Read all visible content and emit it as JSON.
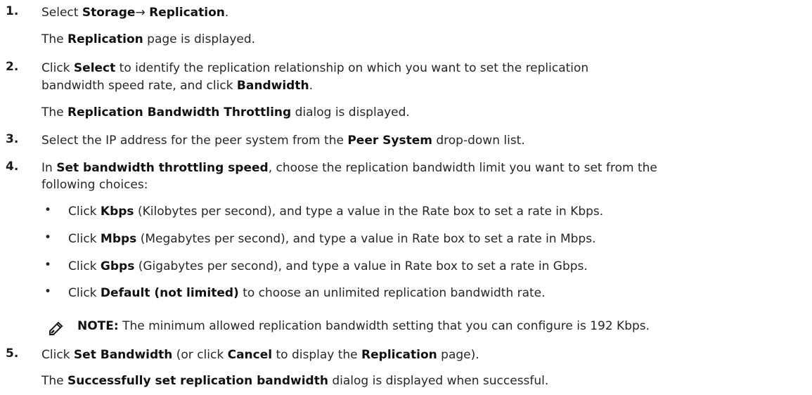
{
  "steps": [
    {
      "number": "1.",
      "line1": {
        "a": "Select ",
        "b1": "Storage",
        "c": "→ ",
        "b2": "Replication",
        "d": "."
      },
      "line2": {
        "a": "The ",
        "b1": "Replication",
        "c": " page is displayed."
      }
    },
    {
      "number": "2.",
      "line1": {
        "a": "Click ",
        "b1": "Select",
        "c": " to identify the replication relationship on which you want to set the replication"
      },
      "line2": {
        "a": "bandwidth speed rate, and click ",
        "b1": "Bandwidth",
        "c": "."
      },
      "line3": {
        "a": "The ",
        "b1": "Replication Bandwidth Throttling",
        "c": " dialog is displayed."
      }
    },
    {
      "number": "3.",
      "line1": {
        "a": "Select the IP address for the peer system from the ",
        "b1": "Peer System",
        "c": " drop-down list."
      }
    },
    {
      "number": "4.",
      "line1": {
        "a": "In ",
        "b1": "Set bandwidth throttling speed",
        "c": ", choose the replication bandwidth limit you want to set from the"
      },
      "line2": {
        "a": "following choices:"
      },
      "bullets": [
        {
          "a": "Click ",
          "b1": "Kbps",
          "c": " (Kilobytes per second), and type a value in the Rate box to set a rate in Kbps."
        },
        {
          "a": "Click ",
          "b1": "Mbps",
          "c": " (Megabytes per second), and type a value in Rate box to set a rate in Mbps."
        },
        {
          "a": "Click ",
          "b1": "Gbps",
          "c": " (Gigabytes per second), and type a value in Rate box to set a rate in Gbps."
        },
        {
          "a": "Click ",
          "b1": "Default (not limited)",
          "c": " to choose an unlimited replication bandwidth rate."
        }
      ],
      "bullet_char": "•"
    },
    {
      "number": "5.",
      "line1": {
        "a": "Click ",
        "b1": "Set Bandwidth",
        "c": " (or click ",
        "b2": "Cancel",
        "d": " to display the ",
        "b3": "Replication",
        "e": " page)."
      },
      "line2": {
        "a": "The ",
        "b1": "Successfully set replication bandwidth",
        "c": " dialog is displayed when successful."
      }
    }
  ],
  "note": {
    "icon": "note-pencil-icon",
    "label": "NOTE:",
    "text": " The minimum allowed replication bandwidth setting that you can configure is 192 Kbps."
  }
}
